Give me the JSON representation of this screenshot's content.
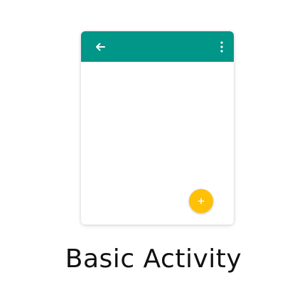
{
  "template": {
    "name": "Basic Activity",
    "colors": {
      "appbar": "#009688",
      "fab": "#ffc107",
      "icon": "#ffffff",
      "card": "#ffffff",
      "label": "#111111"
    },
    "icons": {
      "navigation": "back-arrow-icon",
      "overflow": "more-vert-icon",
      "fab": "plus-icon"
    }
  }
}
